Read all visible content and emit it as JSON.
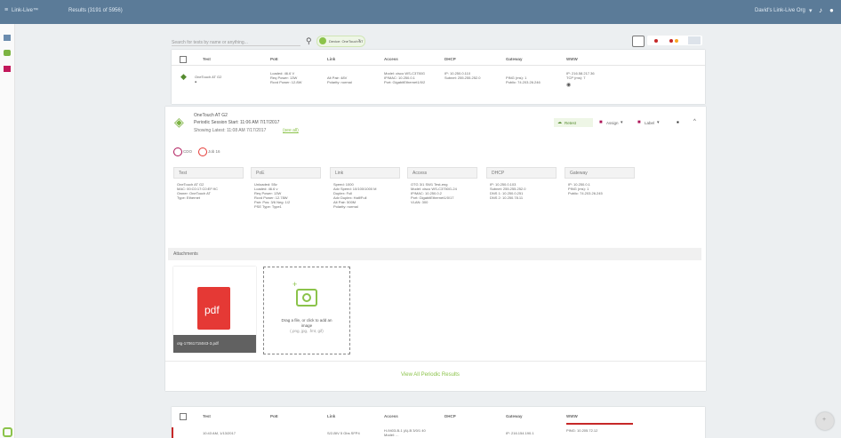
{
  "topbar": {
    "app_title": "Link-Live™",
    "results_label": "Results (3191 of 5956)",
    "user_menu": "David's Link-Live Org"
  },
  "search": {
    "placeholder": "Search for tests by name or anything...",
    "chip_label": "Device: OneTouch AT"
  },
  "table_header": {
    "columns": [
      "Test",
      "PoE",
      "Link",
      "Access",
      "DHCP",
      "Gateway",
      "WWW"
    ]
  },
  "top_row": {
    "test": "OneTouch AT G2",
    "poe": [
      "Loaded: 46.6 V",
      "Req Power: 13W",
      "Rcvd Power: 12.8W"
    ],
    "link": [
      "Alt Pair: 48V",
      "Polarity: normal"
    ],
    "access": [
      "Model: cisco WS-C3750G",
      "IP/MAC: 10.250.0.1",
      "Port: GigabitEthernet1/0/2"
    ],
    "dhcp": [
      "IP: 10.250.0.110",
      "Subnet: 255.255.252.0"
    ],
    "gateway": [
      "PING (ms): 1",
      "Public: 74.203.26.246"
    ],
    "www": [
      "IP: 216.58.217.36",
      "TCP (ms): 7"
    ]
  },
  "detail": {
    "title": "OneTouch AT G2",
    "session_start": "Periodic Session Start: 11:06 AM 7/17/2017",
    "showing_latest": "Showing Latest: 11:08 AM 7/17/2017",
    "showing_link": "(see all)",
    "actions": {
      "retest": "Retest",
      "assign": "Assign",
      "label": "Label"
    },
    "tags": [
      "CDO",
      "Job 16"
    ],
    "sections": [
      {
        "title": "Test",
        "lines": [
          "OneTouch AT G2",
          "MAC: 00:C0:17:C0:EF:9C",
          "Owner: OneTouch AT",
          "Type: Ethernet"
        ]
      },
      {
        "title": "PoE",
        "lines": [
          "Unloaded: 55v",
          "Loaded: 46.6 v",
          "Req Power: 13W",
          "Rcvd Power: 12.78W",
          "Pair: Pos: 3/6 Neg: 1/2",
          "PSE Type: Type1"
        ]
      },
      {
        "title": "Link",
        "lines": [
          "Speed: 1000",
          "Adv Speed: 10/100/1000 M",
          "Duplex: Full",
          "Adv Duplex: Half/Full",
          "Alt Pair: 500M",
          "Polarity: normal"
        ]
      },
      {
        "title": "Access",
        "lines": [
          "OTG 3/1 SW1 Test-eng",
          "Model: cisco WS-C3750G-24",
          "IP/MAC: 10.250.0.2",
          "Port: GigabitEthernet1/0/17",
          "VLAN: 300"
        ]
      },
      {
        "title": "DHCP",
        "lines": [
          "IP: 10.250.0.103",
          "Subnet: 255.255.252.0",
          "DNS 1: 10.250.0.251",
          "DNS 2: 10.250.78.11"
        ]
      },
      {
        "title": "Gateway",
        "lines": [
          "IP: 10.250.0.1",
          "PING (ms): 1",
          "Public: 74.203.26.245"
        ]
      }
    ],
    "attachments_label": "Attachments",
    "pdf_label": "pdf",
    "pdf_filename": "otg-17061715043-3.pdf",
    "dropzone": [
      "Drag a file, or click to add an",
      "image",
      "(.png, jpg, .fmt, gif)"
    ],
    "view_all": "View All Periodic Results"
  },
  "bottom_row": {
    "time": "10:43 AM, 1/13/2017",
    "link": "S/2-BIV 5 Gbs SFP4",
    "access": [
      "H-9403-B-1 (A)-B 3/0/1 40",
      "Model: ..."
    ],
    "gateway": "IP: 216.154.190.1",
    "www": "PING: 10.205.72.12"
  },
  "colors": {
    "topbar": "#5b7b98",
    "accent_green": "#8bc34a",
    "accent_red": "#c62828",
    "pdf_red": "#e53935"
  }
}
